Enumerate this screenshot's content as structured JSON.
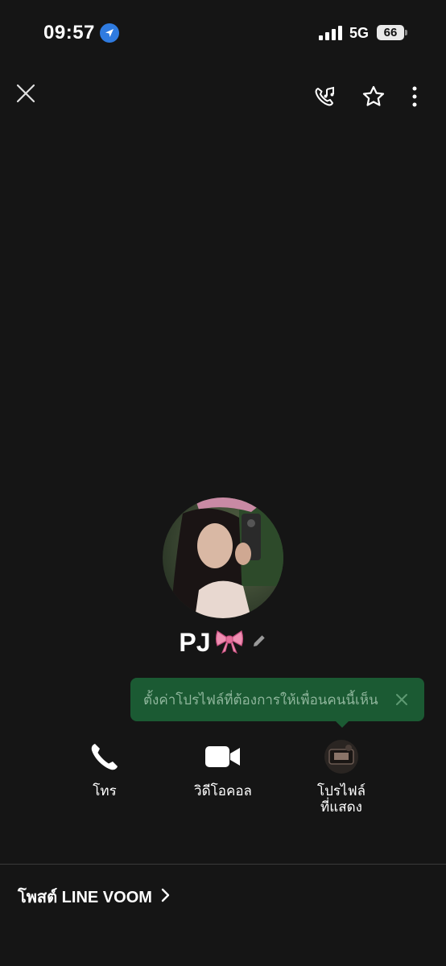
{
  "status_bar": {
    "time": "09:57",
    "network": "5G",
    "battery": "66"
  },
  "top_bar": {
    "icons": [
      "close-icon",
      "phone-music-icon",
      "star-icon",
      "more-vertical-icon"
    ]
  },
  "profile": {
    "name": "PJ",
    "name_emoji": "🎀"
  },
  "tooltip": {
    "text": "ตั้งค่าโปรไฟล์ที่ต้องการให้เพื่อนคนนี้เห็น",
    "bg_color": "#1b5a33"
  },
  "actions": [
    {
      "label": "โทร",
      "icon": "phone-icon"
    },
    {
      "label": "วิดีโอคอล",
      "icon": "video-icon"
    },
    {
      "label_line1": "โปรไฟล์",
      "label_line2": "ที่แสดง",
      "icon": "profile-avatar"
    }
  ],
  "voom": {
    "label": "โพสต์ LINE VOOM"
  },
  "colors": {
    "background": "#151515",
    "location_blue": "#2f7be0"
  }
}
